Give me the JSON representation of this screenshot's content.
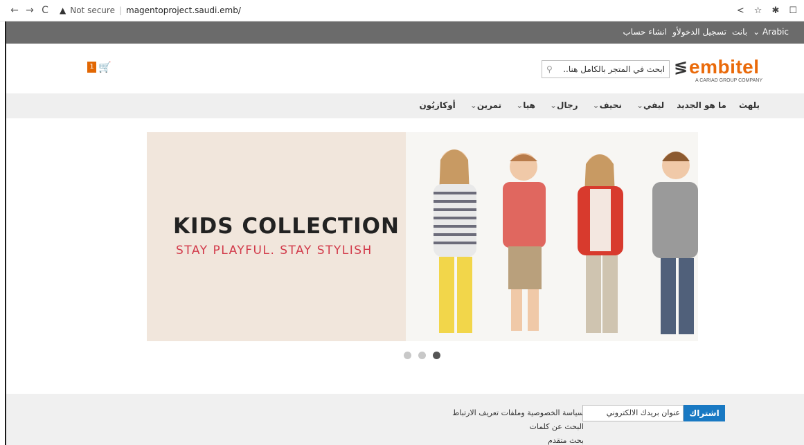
{
  "browser": {
    "security_label": "Not secure",
    "url": "magentoproject.saudi.emb/"
  },
  "topbar": {
    "language": "Arabic",
    "welcome": "بانت",
    "sign_in": "تسجيل الدخول",
    "or": "أو",
    "create_account": "انشاء حساب"
  },
  "header": {
    "cart_count": "1",
    "search_placeholder": "ابحث في المتجر بالكامل هنا..",
    "logo_word": "embitel",
    "logo_tagline": "A CARIAD GROUP COMPANY"
  },
  "nav": {
    "items": [
      {
        "label": "يلهث",
        "has_menu": false
      },
      {
        "label": "ما هو الجديد",
        "has_menu": false
      },
      {
        "label": "ليفي",
        "has_menu": true
      },
      {
        "label": "نحيف",
        "has_menu": true
      },
      {
        "label": "رجال",
        "has_menu": true
      },
      {
        "label": "هيا",
        "has_menu": true
      },
      {
        "label": "تمرين",
        "has_menu": true
      },
      {
        "label": "أوكازيُون",
        "has_menu": false
      }
    ]
  },
  "banner": {
    "title": "KIDS COLLECTION",
    "subtitle": "STAY PLAYFUL. STAY STYLISH",
    "slides": 3,
    "active_slide": 3
  },
  "footer": {
    "links": [
      "سياسة الخصوصية وملفات تعريف الارتباط",
      "البحث عن كلمات",
      "بحث متقدم"
    ],
    "newsletter_placeholder": "عنوان بريدك الالكتروني",
    "subscribe_label": "اشتراك"
  },
  "colors": {
    "brand_orange": "#ea6a0a",
    "topbar_gray": "#6b6b6b",
    "subscribe_blue": "#1979c3",
    "banner_red": "#d23a4a"
  }
}
